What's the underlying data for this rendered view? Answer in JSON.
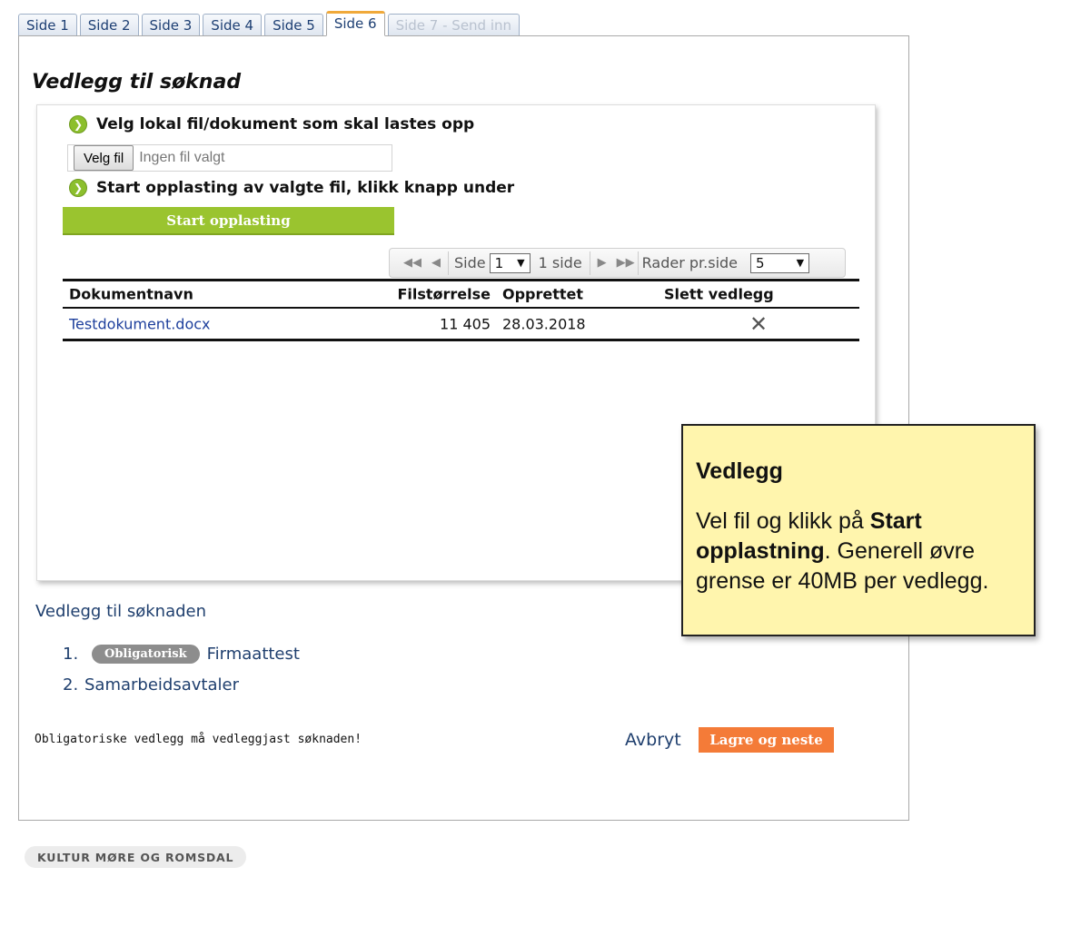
{
  "tabs": [
    {
      "label": "Side 1"
    },
    {
      "label": "Side 2"
    },
    {
      "label": "Side 3"
    },
    {
      "label": "Side 4"
    },
    {
      "label": "Side 5"
    },
    {
      "label": "Side 6",
      "active": true
    },
    {
      "label": "Side 7 - Send inn",
      "disabled": true
    }
  ],
  "page_title": "Vedlegg til søknad",
  "upload": {
    "step1": "Velg lokal fil/dokument som skal lastes opp",
    "choose_file_label": "Velg fil",
    "no_file_text": "Ingen fil valgt",
    "step2": "Start opplasting av valgte fil, klikk knapp under",
    "start_button": "Start opplasting"
  },
  "pager": {
    "page_label": "Side",
    "page_value": "1",
    "page_count_text": "1 side",
    "rows_label": "Rader pr.side",
    "rows_value": "5"
  },
  "table": {
    "headers": {
      "name": "Dokumentnavn",
      "size": "Filstørrelse",
      "created": "Opprettet",
      "delete": "Slett vedlegg"
    },
    "rows": [
      {
        "name": "Testdokument.docx",
        "size": "11 405",
        "created": "28.03.2018"
      }
    ]
  },
  "attachments": {
    "title": "Vedlegg til søknaden",
    "items": [
      {
        "num": "1.",
        "badge": "Obligatorisk",
        "label": "Firmaattest"
      },
      {
        "num": "2.",
        "label": "Samarbeidsavtaler"
      }
    ]
  },
  "footer": {
    "notice": "Obligatoriske vedlegg må vedleggjast søknaden!",
    "cancel": "Avbryt",
    "save_next": "Lagre og neste"
  },
  "org_badge": "KULTUR MØRE OG ROMSDAL",
  "tooltip": {
    "title": "Vedlegg",
    "text_before": "Vel fil og klikk på ",
    "text_bold": "Start opplastning",
    "text_after": ". Generell øvre grense er 40MB per vedlegg."
  },
  "colors": {
    "accent_green": "#9ac42f",
    "save_orange": "#f47b38",
    "tooltip_bg": "#fff5ad",
    "active_tab_border": "#f0a93a",
    "link_blue": "#1f3f6e"
  },
  "icons": {
    "step_bullet": "green-chevron-circle-icon",
    "first_page": "double-left-arrow-icon",
    "prev_page": "left-arrow-icon",
    "next_page": "right-arrow-icon",
    "last_page": "double-right-arrow-icon",
    "delete": "close-icon"
  }
}
